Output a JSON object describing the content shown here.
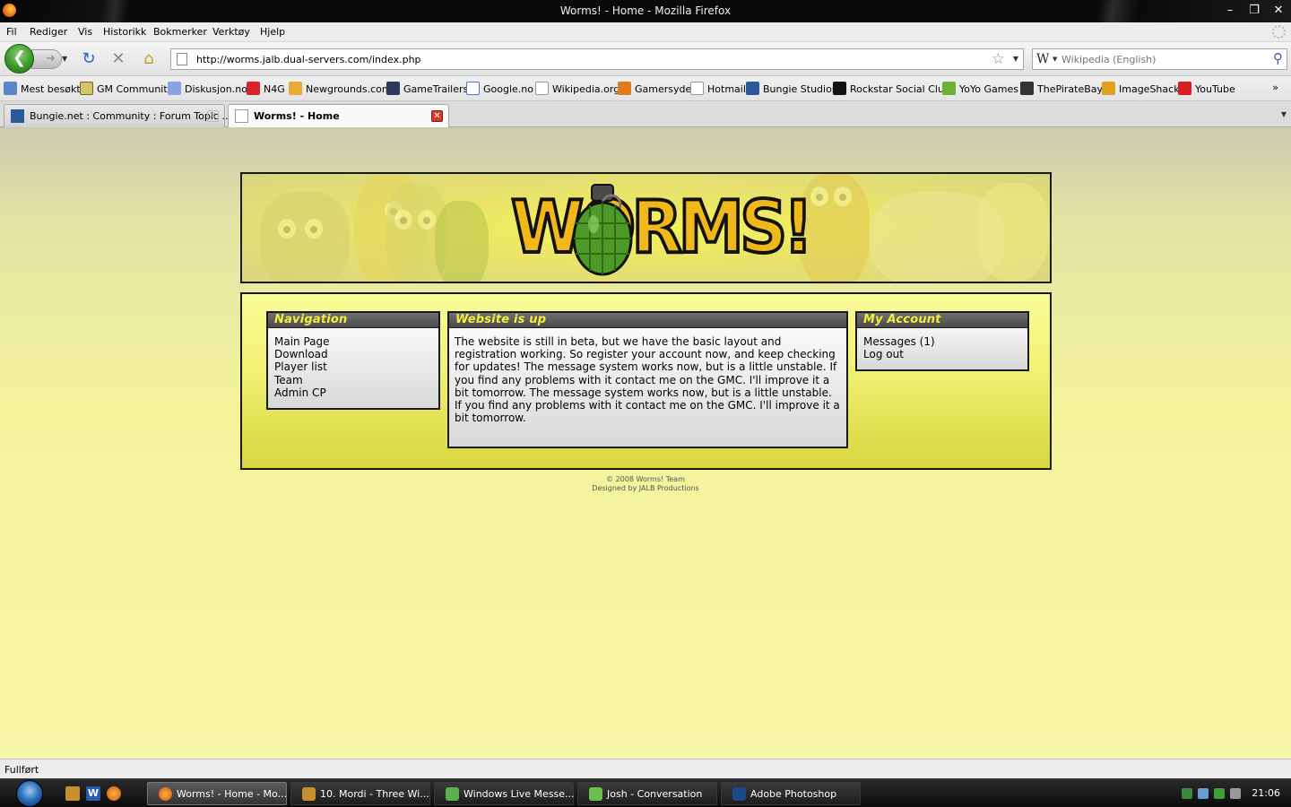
{
  "window": {
    "title": "Worms! - Home - Mozilla Firefox"
  },
  "menu": [
    "Fil",
    "Rediger",
    "Vis",
    "Historikk",
    "Bokmerker",
    "Verktøy",
    "Hjelp"
  ],
  "nav": {
    "url": "http://worms.jalb.dual-servers.com/index.php",
    "search_placeholder": "Wikipedia (English)"
  },
  "bookmarks": [
    "Mest besøkt",
    "GM Community",
    "Diskusjon.no",
    "N4G",
    "Newgrounds.com",
    "GameTrailers",
    "Google.no",
    "Wikipedia.org",
    "Gamersyde",
    "Hotmail",
    "Bungie Studios",
    "Rockstar Social Club",
    "YoYo Games",
    "ThePirateBay",
    "ImageShack",
    "YouTube"
  ],
  "bookmarks_more": "»",
  "tabs": [
    {
      "label": "Bungie.net : Community : Forum Topic ...",
      "active": false
    },
    {
      "label": "Worms! - Home",
      "active": true
    }
  ],
  "page": {
    "logo_text": "WORMS!",
    "navigation": {
      "title": "Navigation",
      "links": [
        "Main Page",
        "Download",
        "Player list",
        "Team",
        "Admin CP"
      ]
    },
    "news": {
      "title": "Website is up",
      "body": "The website is still in beta, but we have the basic layout and registration working. So register your account now, and keep checking for updates! The message system works now, but is a little unstable. If you find any problems with it contact me on the GMC. I'll improve it a bit tomorrow. The message system works now, but is a little unstable. If you find any problems with it contact me on the GMC. I'll improve it a bit tomorrow."
    },
    "account": {
      "title": "My Account",
      "links": [
        "Messages (1)",
        "Log out"
      ]
    },
    "footer": {
      "copyright": "© 2008 Worms! Team",
      "designed_by": "Designed by JALB Productions"
    }
  },
  "status": "Fullført",
  "taskbar": {
    "buttons": [
      {
        "label": "Worms! - Home - Mo...",
        "active": true
      },
      {
        "label": "10. Mordi - Three Wi...",
        "active": false
      },
      {
        "label": "Windows Live Messe...",
        "active": false
      },
      {
        "label": "Josh - Conversation",
        "active": false
      },
      {
        "label": "Adobe Photoshop",
        "active": false
      }
    ],
    "clock": "21:06"
  },
  "colors": {
    "panel_title": "#f4ee3a",
    "panel_header": "#555555",
    "page_bg": "#f5f5a0",
    "main_box": "#e9e95c"
  }
}
